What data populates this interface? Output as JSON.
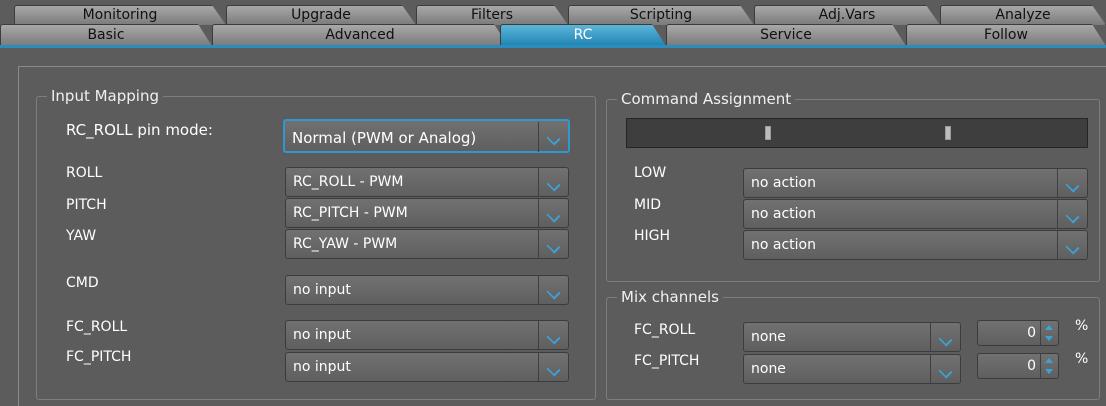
{
  "tabs_back": [
    "Monitoring",
    "Upgrade",
    "Filters",
    "Scripting",
    "Adj.Vars",
    "Analyze"
  ],
  "tabs_front": [
    "Basic",
    "Advanced",
    "RC",
    "Service",
    "Follow"
  ],
  "input_mapping": {
    "title": "Input Mapping",
    "pin_mode_label": "RC_ROLL pin mode:",
    "pin_mode_value": "Normal (PWM or Analog)",
    "roll_label": "ROLL",
    "roll_value": "RC_ROLL - PWM",
    "pitch_label": "PITCH",
    "pitch_value": "RC_PITCH - PWM",
    "yaw_label": "YAW",
    "yaw_value": "RC_YAW - PWM",
    "cmd_label": "CMD",
    "cmd_value": "no input",
    "fc_roll_label": "FC_ROLL",
    "fc_roll_value": "no input",
    "fc_pitch_label": "FC_PITCH",
    "fc_pitch_value": "no input"
  },
  "command_assignment": {
    "title": "Command Assignment",
    "low_label": "LOW",
    "low_value": "no action",
    "mid_label": "MID",
    "mid_value": "no action",
    "high_label": "HIGH",
    "high_value": "no action"
  },
  "mix_channels": {
    "title": "Mix channels",
    "fc_roll_label": "FC_ROLL",
    "fc_roll_value": "none",
    "fc_roll_pct": "0",
    "fc_pitch_label": "FC_PITCH",
    "fc_pitch_value": "none",
    "fc_pitch_pct": "0",
    "unit": "%"
  },
  "colors": {
    "accent": "#2f98d2",
    "background": "#5c5c5c"
  }
}
